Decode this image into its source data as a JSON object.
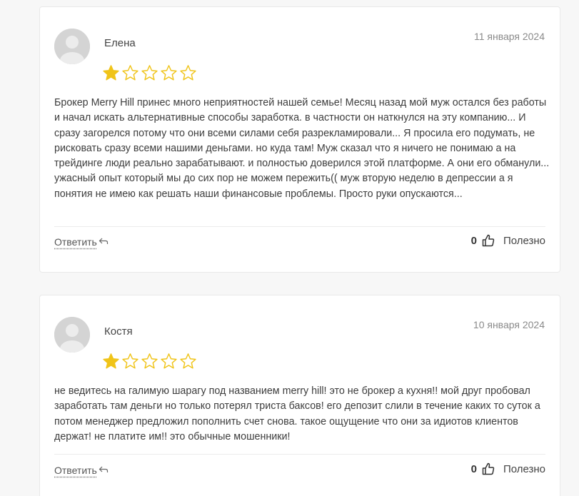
{
  "colors": {
    "star": "#f0c419",
    "card_bg": "#ffffff",
    "page_bg": "#f7f7f7"
  },
  "reviews": [
    {
      "author": "Елена",
      "date": "11 января 2024",
      "rating": 1,
      "max_rating": 5,
      "text": "Брокер Merry Hill принес много неприятностей нашей семье! Месяц назад мой муж остался без работы и начал искать альтернативные способы заработка. в частности он наткнулся на эту компанию... И сразу загорелся потому что они всеми силами себя разрекламировали... Я просила его подумать, не рисковать сразу всеми нашими деньгами. но куда там! Муж сказал что я ничего не понимаю а на трейдинге люди реально зарабатывают. и полностью доверился этой платформе. А они его обманули... ужасный опыт который мы до сих пор не можем пережить(( муж вторую неделю в депрессии а я понятия не имею как решать наши финансовые проблемы. Просто руки опускаются...",
      "reply_label": "Ответить",
      "helpful_count": "0",
      "helpful_label": "Полезно"
    },
    {
      "author": "Костя",
      "date": "10 января 2024",
      "rating": 1,
      "max_rating": 5,
      "text": "не ведитесь на галимую шарагу под названием merry hill! это не брокер а кухня!! мой друг пробовал заработать там деньги но только потерял триста баксов! его депозит слили в течение каких то суток а потом менеджер предложил пополнить счет снова. такое ощущение что они за идиотов клиентов держат! не платите им!! это обычные мошенники!",
      "reply_label": "Ответить",
      "helpful_count": "0",
      "helpful_label": "Полезно"
    }
  ]
}
